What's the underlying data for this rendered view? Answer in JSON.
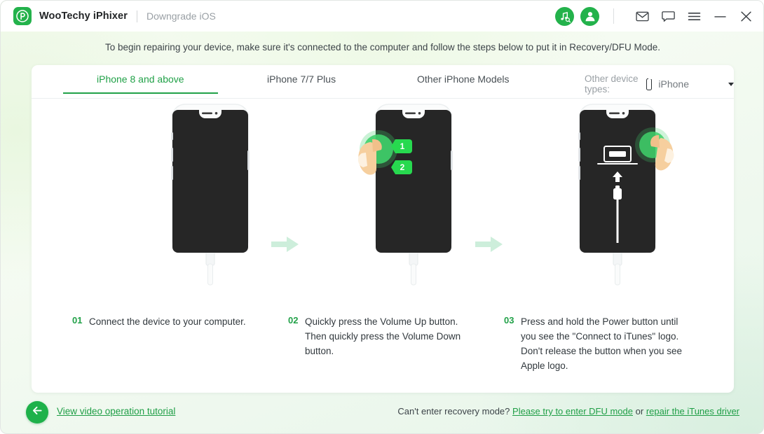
{
  "window": {
    "app_title": "WooTechy iPhixer",
    "subtitle": "Downgrade iOS",
    "logo_icon": "wootechy-p-logo",
    "icons": {
      "itunes_search": "itunes-music-search-icon",
      "account": "user-account-icon",
      "mail": "mail-icon",
      "feedback": "chat-bubble-icon",
      "menu": "hamburger-menu-icon",
      "minimize": "minimize-icon",
      "close": "close-icon"
    }
  },
  "banner": {
    "text": "To begin repairing your device, make sure it's connected to the computer and follow the steps below to put it in Recovery/DFU Mode."
  },
  "tabs": [
    {
      "label": "iPhone 8 and above",
      "active": true
    },
    {
      "label": "iPhone 7/7 Plus",
      "active": false
    },
    {
      "label": "Other iPhone Models",
      "active": false
    }
  ],
  "device_select": {
    "label": "Other device types:",
    "value": "iPhone",
    "icon": "phone-outline-icon",
    "caret": "chevron-down-icon"
  },
  "illustrations": [
    {
      "name": "iphone-connected-to-computer",
      "badges": [],
      "screen": "off"
    },
    {
      "name": "iphone-volume-buttons-press",
      "badges": [
        "1",
        "2"
      ],
      "screen": "off"
    },
    {
      "name": "iphone-connect-to-itunes-screen",
      "badges": [],
      "screen": "connect-to-itunes"
    }
  ],
  "steps": [
    {
      "num": "01",
      "text": "Connect the device to your computer."
    },
    {
      "num": "02",
      "text": "Quickly press the Volume Up button. Then quickly press the Volume Down button."
    },
    {
      "num": "03",
      "text": "Press and hold the Power button until you see the \"Connect to iTunes\" logo. Don't release the button when you see Apple logo."
    }
  ],
  "footer": {
    "back_icon": "arrow-left-icon",
    "tutorial_link": "View video operation tutorial",
    "question": "Can't enter recovery mode?",
    "dfu_link": "Please try to enter DFU mode",
    "or": "or",
    "itunes_link": "repair the iTunes driver"
  },
  "colors": {
    "brand_green": "#23b24b",
    "link_green": "#1f9e46",
    "tab_active": "#21a148",
    "badge_green": "#27d94f",
    "arrow_mint": "#cdeedb",
    "text_dark": "#31383d",
    "text_muted": "#9aa0a5",
    "phone_body": "#fbfcfc",
    "phone_screen": "#262626"
  }
}
